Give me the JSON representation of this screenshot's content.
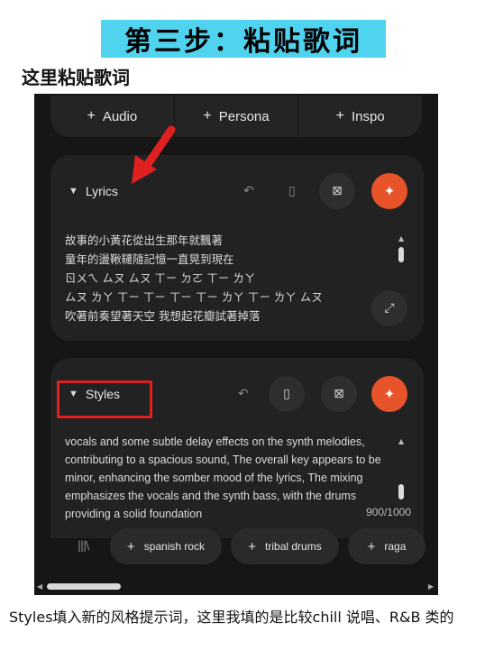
{
  "title": "第三步：粘贴歌词",
  "subtitle": "这里粘贴歌词",
  "colors": {
    "accent_orange": "#e8542a",
    "title_bg": "#4fd3ee",
    "highlight_red": "#e02020",
    "panel_bg": "#161616"
  },
  "top_bar": {
    "items": [
      {
        "label": "Audio",
        "icon": "plus-icon"
      },
      {
        "label": "Persona",
        "icon": "plus-icon"
      },
      {
        "label": "Inspo",
        "icon": "plus-icon"
      }
    ]
  },
  "lyrics": {
    "label": "Lyrics",
    "lines": [
      "故事的小黃花從出生那年就飄著",
      "童年的盪鞦韆隨記憶一直晃到現在",
      "ㄖㄨㄟ ㄙㄡ ㄙㄡ ㄒㄧ ㄉㄛ ㄒㄧ ㄌㄚ",
      "ㄙㄡ ㄌㄚ ㄒㄧ ㄒㄧ ㄒㄧ ㄒㄧ ㄌㄚ ㄒㄧ ㄌㄚ ㄙㄡ",
      "吹著前奏望著天空 我想起花瓣試著掉落"
    ],
    "icons": [
      "undo-icon",
      "bookmark-icon",
      "delete-icon",
      "magic-wand-icon",
      "expand-icon"
    ]
  },
  "styles": {
    "label": "Styles",
    "text": "vocals and some subtle delay effects on the synth melodies, contributing to a spacious sound, The overall key appears to be minor, enhancing the somber mood of the lyrics, The mixing emphasizes the vocals and the synth bass, with the drums providing a solid foundation",
    "counter": "900/1000",
    "icons": [
      "undo-icon",
      "bookmark-icon",
      "delete-icon",
      "magic-wand-icon"
    ]
  },
  "chips": [
    {
      "label": "spanish rock"
    },
    {
      "label": "tribal drums"
    },
    {
      "label": "raga"
    }
  ],
  "footer": "Styles填入新的风格提示词，这里我填的是比较chill 说唱、R&B 类的"
}
